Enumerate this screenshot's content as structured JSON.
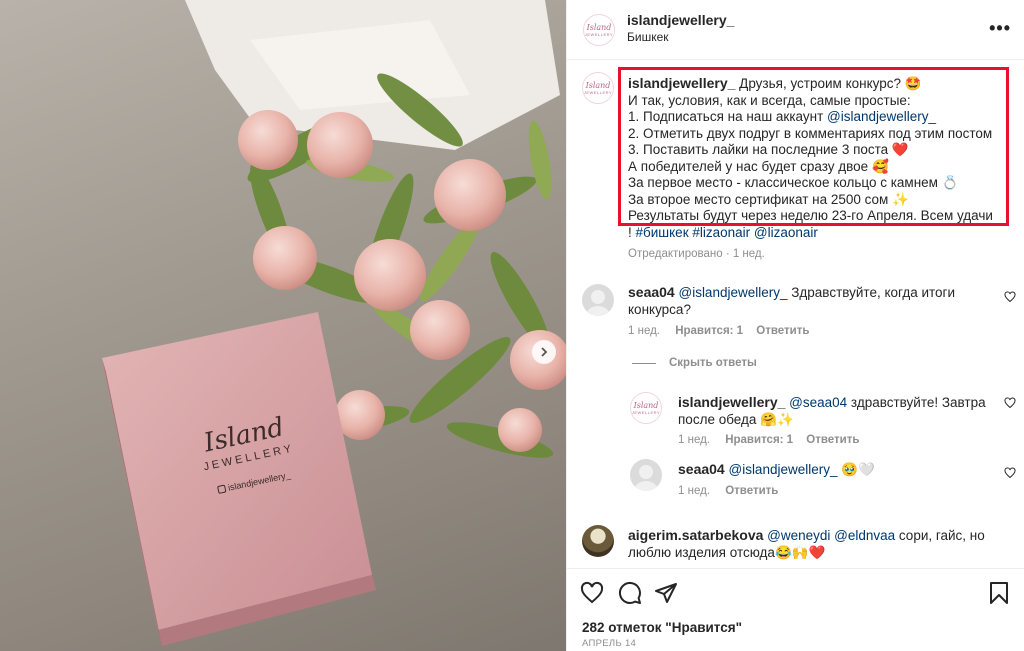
{
  "photo": {
    "box_brand_line1": "Island",
    "box_brand_line2": "JEWELLERY",
    "box_handle": "islandjewellery_"
  },
  "header": {
    "avatar_line1": "Island",
    "avatar_line2": "JEWELLERY",
    "username": "islandjewellery_",
    "location": "Бишкек",
    "more": "•••"
  },
  "caption": {
    "username": "islandjewellery_",
    "line1": "Друзья, устроим конкурс? 🤩",
    "line2": "И так, условия, как и всегда, самые простые:",
    "line3_text": "1. Подписаться на наш аккаунт ",
    "line3_link": "@islandjewellery_",
    "line4": "2. Отметить двух подруг в комментариях под этим постом",
    "line5": "3. Поставить лайки на последние 3 поста ❤️",
    "line6": "А победителей у нас будет сразу двое 🥰",
    "line7": "За первое место - классическое кольцо с камнем 💍",
    "line8": "За второе место сертификат на 2500 сом ✨",
    "line9": "Результаты будут через неделю 23-го Апреля. Всем удачи",
    "line10_prefix": "! ",
    "hashtags": "#бишкек #lizaonair @lizaonair",
    "edited": "Отредактировано · 1 нед."
  },
  "comments": [
    {
      "username": "seaa04",
      "mention": "@islandjewellery_",
      "text_line1": " Здравствуйте, когда итоги",
      "text_line2": "конкурса?",
      "time": "1 нед.",
      "likes": "Нравится: 1",
      "reply": "Ответить",
      "hide_replies": "Скрыть ответы"
    },
    {
      "username": "islandjewellery_",
      "mention": "@seaa04",
      "text_line1": " здравствуйте! Завтра",
      "text_line2": "после обеда 🤗✨",
      "time": "1 нед.",
      "likes": "Нравится: 1",
      "reply": "Ответить"
    },
    {
      "username": "seaa04",
      "mention": "@islandjewellery_",
      "text_line1": " 🥹🤍",
      "time": "1 нед.",
      "reply": "Ответить"
    },
    {
      "username": "aigerim.satarbekova",
      "mention": "@weneydi @eldnvaa",
      "text_line1": " сори, гайс, но",
      "text_line2": "люблю изделия отсюда😂🙌❤️"
    }
  ],
  "footer": {
    "likes": "282 отметок \"Нравится\"",
    "date": "АПРЕЛЬ 14"
  },
  "colors": {
    "highlight": "#e8112d",
    "link": "#00376b",
    "meta": "#8e8e8e",
    "box_pink": "#d9a3a6"
  }
}
